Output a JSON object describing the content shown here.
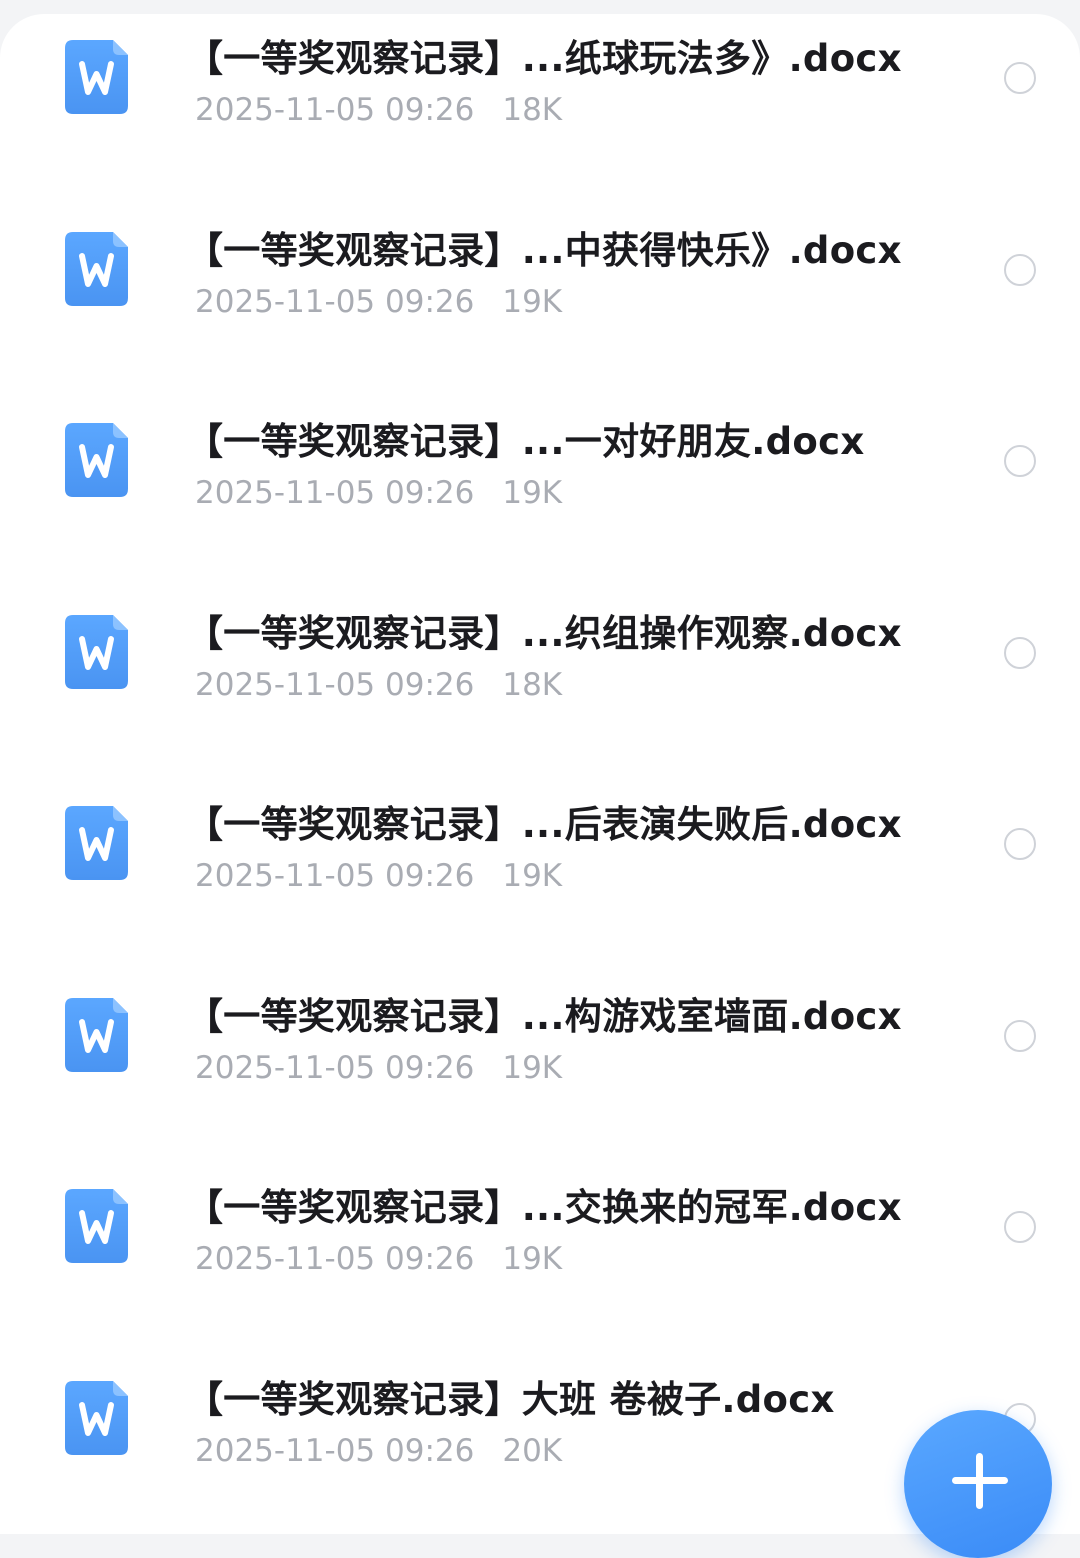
{
  "files": [
    {
      "name": "【一等奖观察记录】...纸球玩法多》.docx",
      "date": "2025-11-05 09:26",
      "size": "18K"
    },
    {
      "name": "【一等奖观察记录】...中获得快乐》.docx",
      "date": "2025-11-05 09:26",
      "size": "19K"
    },
    {
      "name": "【一等奖观察记录】...一对好朋友.docx",
      "date": "2025-11-05 09:26",
      "size": "19K"
    },
    {
      "name": "【一等奖观察记录】...织组操作观察.docx",
      "date": "2025-11-05 09:26",
      "size": "18K"
    },
    {
      "name": "【一等奖观察记录】...后表演失败后.docx",
      "date": "2025-11-05 09:26",
      "size": "19K"
    },
    {
      "name": "【一等奖观察记录】...构游戏室墙面.docx",
      "date": "2025-11-05 09:26",
      "size": "19K"
    },
    {
      "name": "【一等奖观察记录】...交换来的冠军.docx",
      "date": "2025-11-05 09:26",
      "size": "19K"
    },
    {
      "name": "【一等奖观察记录】大班 卷被子.docx",
      "date": "2025-11-05 09:26",
      "size": "20K"
    }
  ],
  "icons": {
    "file_icon": "word-document-icon",
    "select_icon": "radio-unchecked-icon",
    "fab_icon": "plus-icon"
  },
  "colors": {
    "word_icon": "#4f9bf5",
    "title_text": "#1b1b1f",
    "meta_text": "#a9acb3",
    "fab": "#3a8bf7"
  }
}
